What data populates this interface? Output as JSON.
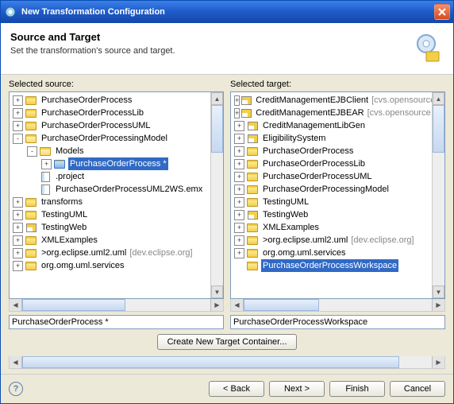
{
  "window": {
    "title": "New Transformation Configuration"
  },
  "header": {
    "title": "Source and Target",
    "subtitle": "Set the transformation's source and target."
  },
  "labels": {
    "selected_source": "Selected source:",
    "selected_target": "Selected target:"
  },
  "source_tree": [
    {
      "depth": 0,
      "tw": "+",
      "icon": "folder",
      "label": "PurchaseOrderProcess"
    },
    {
      "depth": 0,
      "tw": "+",
      "icon": "folder",
      "label": "PurchaseOrderProcessLib"
    },
    {
      "depth": 0,
      "tw": "+",
      "icon": "folder",
      "label": "PurchaseOrderProcessUML"
    },
    {
      "depth": 0,
      "tw": "-",
      "icon": "folder-open",
      "label": "PurchaseOrderProcessingModel"
    },
    {
      "depth": 1,
      "tw": "-",
      "icon": "folder-open",
      "label": "Models"
    },
    {
      "depth": 2,
      "tw": "+",
      "icon": "folder-blue",
      "label": "PurchaseOrderProcess *",
      "sel": true
    },
    {
      "depth": 1,
      "tw": " ",
      "icon": "file",
      "label": ".project"
    },
    {
      "depth": 1,
      "tw": " ",
      "icon": "file",
      "label": "PurchaseOrderProcessUML2WS.emx"
    },
    {
      "depth": 0,
      "tw": "+",
      "icon": "folder",
      "label": "transforms"
    },
    {
      "depth": 0,
      "tw": "+",
      "icon": "folder",
      "label": "TestingUML"
    },
    {
      "depth": 0,
      "tw": "+",
      "icon": "proj",
      "label": "TestingWeb"
    },
    {
      "depth": 0,
      "tw": "+",
      "icon": "folder",
      "label": "XMLExamples"
    },
    {
      "depth": 0,
      "tw": "+",
      "icon": "folder",
      "label": ">org.eclipse.uml2.uml",
      "repo": "[dev.eclipse.org]"
    },
    {
      "depth": 0,
      "tw": "+",
      "icon": "folder",
      "label": "org.omg.uml.services"
    }
  ],
  "target_tree": [
    {
      "depth": 0,
      "tw": "+",
      "icon": "proj",
      "label": "CreditManagementEJBClient",
      "repo": "[cvs.opensource.il"
    },
    {
      "depth": 0,
      "tw": "+",
      "icon": "proj",
      "label": "CreditManagementEJBEAR",
      "repo": "[cvs.opensource.ib"
    },
    {
      "depth": 0,
      "tw": "+",
      "icon": "proj",
      "label": "CreditManagementLibGen"
    },
    {
      "depth": 0,
      "tw": "+",
      "icon": "proj",
      "label": "EligibilitySystem"
    },
    {
      "depth": 0,
      "tw": "+",
      "icon": "folder",
      "label": "PurchaseOrderProcess"
    },
    {
      "depth": 0,
      "tw": "+",
      "icon": "folder",
      "label": "PurchaseOrderProcessLib"
    },
    {
      "depth": 0,
      "tw": "+",
      "icon": "folder",
      "label": "PurchaseOrderProcessUML"
    },
    {
      "depth": 0,
      "tw": "+",
      "icon": "folder",
      "label": "PurchaseOrderProcessingModel"
    },
    {
      "depth": 0,
      "tw": "+",
      "icon": "folder",
      "label": "TestingUML"
    },
    {
      "depth": 0,
      "tw": "+",
      "icon": "proj",
      "label": "TestingWeb"
    },
    {
      "depth": 0,
      "tw": "+",
      "icon": "folder",
      "label": "XMLExamples"
    },
    {
      "depth": 0,
      "tw": "+",
      "icon": "folder",
      "label": ">org.eclipse.uml2.uml",
      "repo": "[dev.eclipse.org]"
    },
    {
      "depth": 0,
      "tw": "+",
      "icon": "folder",
      "label": "org.omg.uml.services"
    },
    {
      "depth": 0,
      "tw": " ",
      "icon": "folder",
      "label": "PurchaseOrderProcessWorkspace",
      "sel": true
    }
  ],
  "inputs": {
    "source_value": "PurchaseOrderProcess *",
    "target_value": "PurchaseOrderProcessWorkspace"
  },
  "buttons": {
    "create_target": "Create New Target Container...",
    "back": "< Back",
    "next": "Next >",
    "finish": "Finish",
    "cancel": "Cancel"
  }
}
